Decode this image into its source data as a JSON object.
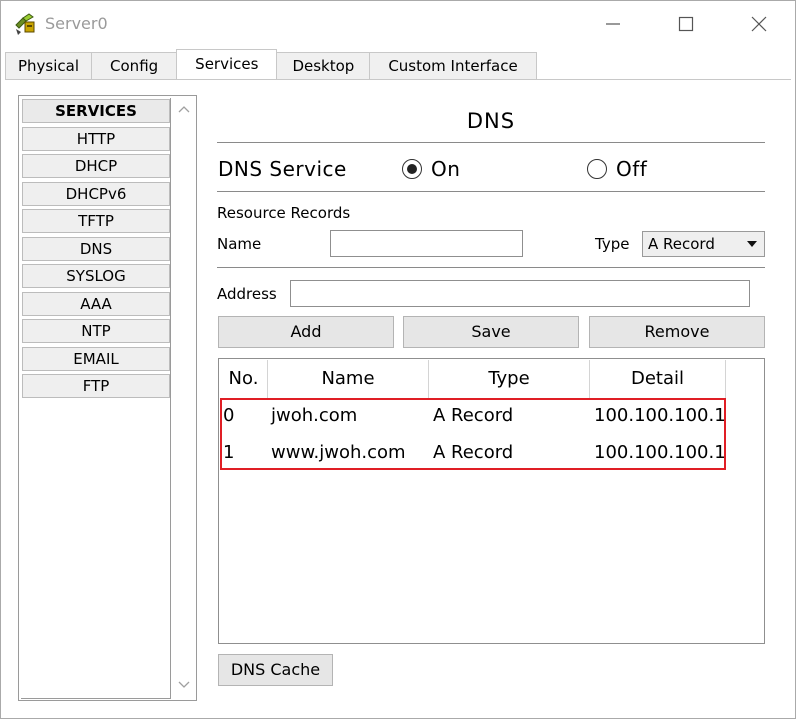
{
  "window": {
    "title": "Server0"
  },
  "tabs": [
    {
      "label": "Physical"
    },
    {
      "label": "Config"
    },
    {
      "label": "Services"
    },
    {
      "label": "Desktop"
    },
    {
      "label": "Custom Interface"
    }
  ],
  "sidebar": {
    "header": "SERVICES",
    "items": [
      "HTTP",
      "DHCP",
      "DHCPv6",
      "TFTP",
      "DNS",
      "SYSLOG",
      "AAA",
      "NTP",
      "EMAIL",
      "FTP"
    ]
  },
  "dns": {
    "title": "DNS",
    "service_label": "DNS Service",
    "on_label": "On",
    "off_label": "Off",
    "selected": "On",
    "resource_records_label": "Resource Records",
    "name_label": "Name",
    "name_value": "",
    "type_label": "Type",
    "type_value": "A Record",
    "address_label": "Address",
    "address_value": "",
    "add_label": "Add",
    "save_label": "Save",
    "remove_label": "Remove",
    "cache_label": "DNS Cache"
  },
  "table": {
    "columns": [
      "No.",
      "Name",
      "Type",
      "Detail"
    ],
    "rows": [
      {
        "no": "0",
        "name": "jwoh.com",
        "type": "A Record",
        "detail": "100.100.100.1"
      },
      {
        "no": "1",
        "name": "www.jwoh.com",
        "type": "A Record",
        "detail": "100.100.100.1"
      }
    ]
  },
  "colors": {
    "highlight": "#e01e25"
  },
  "icons": {
    "app": "server-tools-icon",
    "minimize": "minimize-icon",
    "maximize": "maximize-icon",
    "close": "close-icon"
  }
}
